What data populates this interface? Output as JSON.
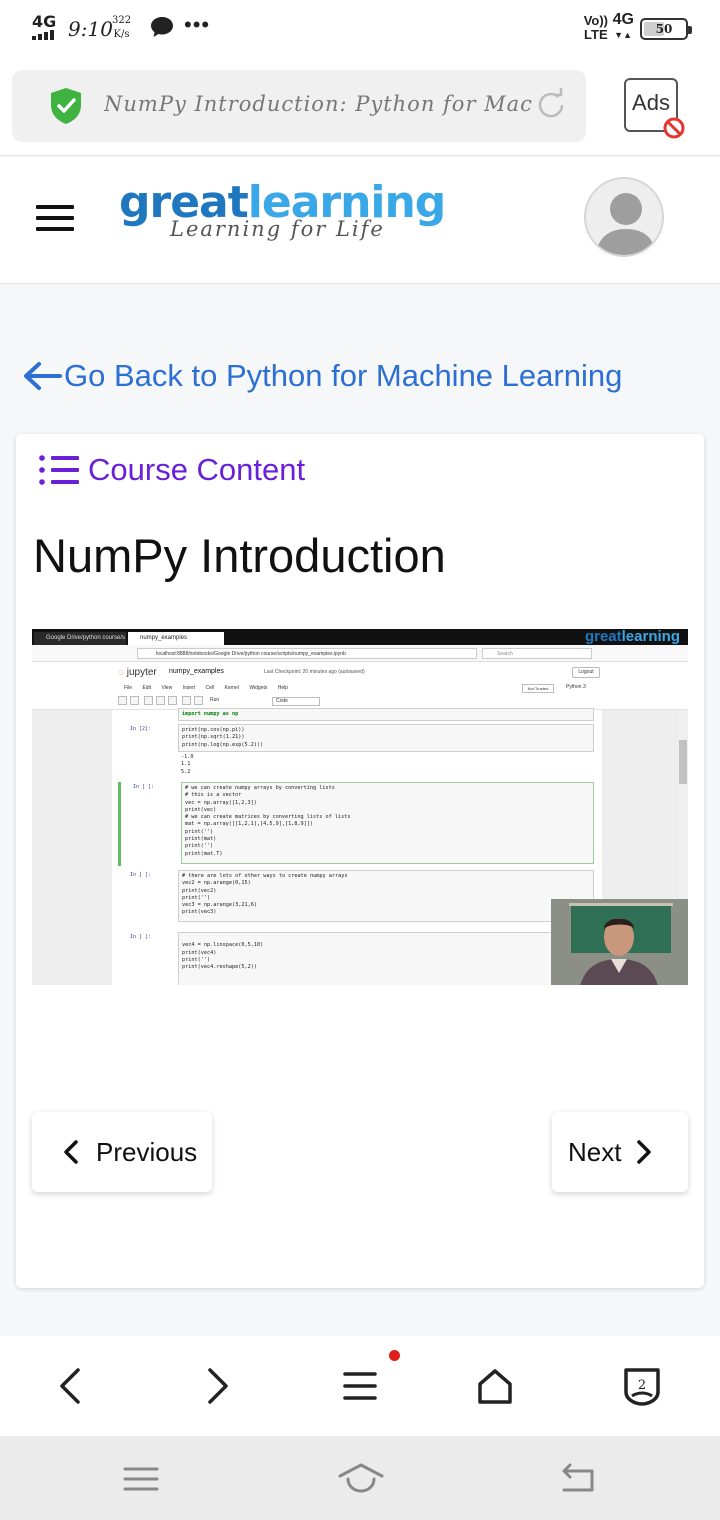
{
  "status_bar": {
    "network": "4G",
    "time": "9:10",
    "speed_value": "322",
    "speed_unit": "K/s",
    "volte_top": "Vo))",
    "volte_bottom": "LTE",
    "network_right": "4G",
    "battery_level": "50",
    "battery_fraction": 0.5
  },
  "browser": {
    "url_title": "NumPy Introduction: Python for Mac...",
    "ads_label": "Ads",
    "icons": [
      "shield-check-icon",
      "reload-icon",
      "ads-blocked-icon"
    ]
  },
  "site": {
    "logo_part1": "great",
    "logo_part2": "learning",
    "tagline": "Learning for Life",
    "colors": {
      "logo_dark": "#1f78bf",
      "logo_light": "#3aa8e6",
      "link_blue": "#2d6fd3",
      "purple": "#6a1fd8"
    }
  },
  "back_link": "Go Back to Python for Machine Learning",
  "course_content_label": "Course Content",
  "lesson_title": "NumPy Introduction",
  "video": {
    "tab1": "Google Drive/python course/s",
    "tab2": "numpy_examples",
    "logo_part1": "great",
    "logo_part2": "learning",
    "url": "localhost:8888/notebooks/Google Drive/python course/scripts/numpy_examples.ipynb",
    "search_placeholder": "Search",
    "jupyter_label": "jupyter",
    "notebook_name": "numpy_examples",
    "checkpoint": "Last Checkpoint: 20 minutes ago  (autosaved)",
    "logout": "Logout",
    "menu": "File Edit View Insert Cell Kernel Widgets Help",
    "not_trusted": "Not Trusted",
    "kernel": "Python 3",
    "run_label": "Run",
    "cell_type": "Code",
    "cells": {
      "c0_code": "import numpy as np",
      "c1_prompt": "In [2]:",
      "c1_code": "print(np.cos(np.pi))\nprint(np.sqrt(1.21))\nprint(np.log(np.exp(5.2)))",
      "c1_out": "-1.0\n1.1\n5.2",
      "c2_prompt": "In [ ]:",
      "c2_code": "# we can create numpy arrays by converting lists\n# this is a vector\nvec = np.array([1,2,3])\nprint(vec)\n# we can create matrices by converting lists of lists\nmat = np.array([[1,2,1],[4,5,9],[1,8,9]])\nprint('')\nprint(mat)\nprint('')\nprint(mat.T)",
      "c3_prompt": "In [ ]:",
      "c3_code": "# there are lots of other ways to create numpy arrays\nvec2 = np.arange(0,15)\nprint(vec2)\nprint('')\nvec3 = np.arange(3,21,6)\nprint(vec3)",
      "c4_prompt": "In [ ]:",
      "c4_code": "\nvec4 = np.linspace(0,5,10)\nprint(vec4)\nprint('')\nprint(vec4.reshape(5,2))"
    }
  },
  "pager": {
    "previous": "Previous",
    "next": "Next"
  },
  "bottom_nav": {
    "items": [
      "back-icon",
      "forward-icon",
      "menu-icon",
      "home-icon",
      "tabs-icon"
    ],
    "tab_count": "2"
  },
  "system_nav": {
    "items": [
      "recents-icon",
      "home-icon",
      "back-icon"
    ]
  }
}
